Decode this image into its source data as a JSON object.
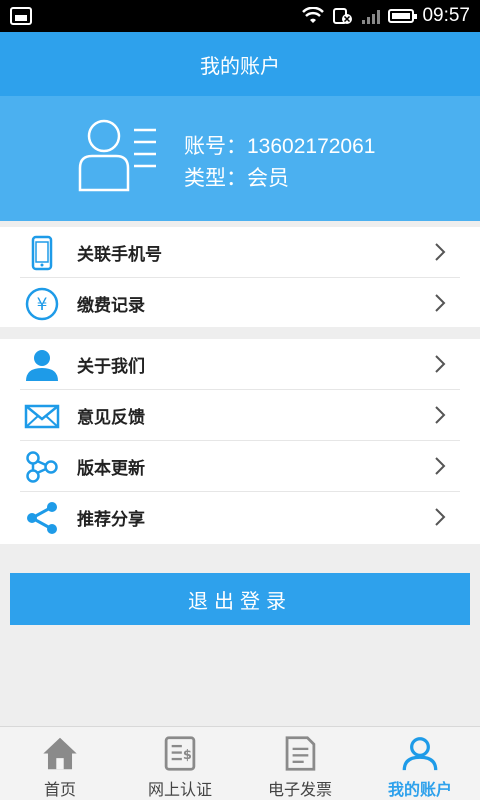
{
  "status_bar": {
    "time": "09:57"
  },
  "header": {
    "title": "我的账户"
  },
  "profile": {
    "account_line": "账号：13602172061",
    "type_line": "类型：会员"
  },
  "group1": [
    {
      "label": "关联手机号",
      "icon": "phone-icon"
    },
    {
      "label": "缴费记录",
      "icon": "yen-icon"
    }
  ],
  "group2": [
    {
      "label": "关于我们",
      "icon": "person-icon"
    },
    {
      "label": "意见反馈",
      "icon": "mail-icon"
    },
    {
      "label": "版本更新",
      "icon": "update-icon"
    },
    {
      "label": "推荐分享",
      "icon": "share-icon"
    }
  ],
  "logout": {
    "label": "退出登录"
  },
  "tabs": [
    {
      "label": "首页",
      "icon": "home-icon",
      "active": false
    },
    {
      "label": "网上认证",
      "icon": "certification-icon",
      "active": false
    },
    {
      "label": "电子发票",
      "icon": "invoice-icon",
      "active": false
    },
    {
      "label": "我的账户",
      "icon": "account-icon",
      "active": true
    }
  ],
  "colors": {
    "primary": "#2ea1ec",
    "profile_bg": "#4bb0f0",
    "icon_blue": "#1e9be8"
  }
}
